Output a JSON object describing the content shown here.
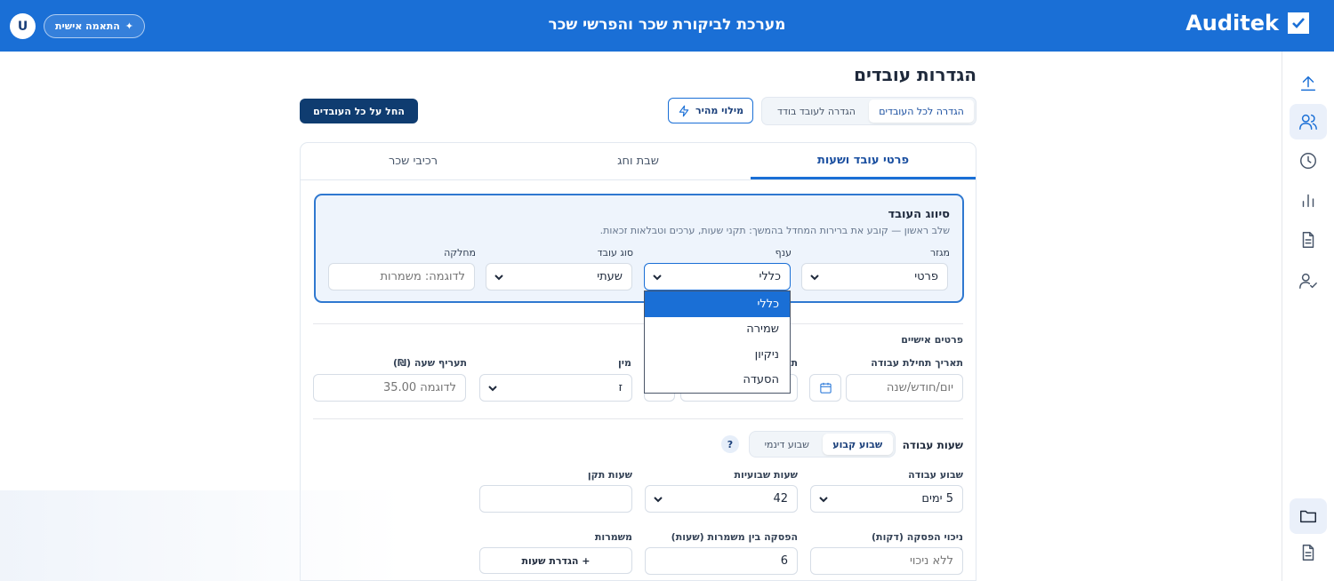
{
  "header": {
    "brand": "Auditek",
    "title": "מערכת לביקורת שכר והפרשי שכר",
    "personal_label": "התאמה אישית",
    "avatar_letter": "U"
  },
  "page": {
    "title": "הגדרות עובדים",
    "mode_options": [
      "הגדרה לכל העובדים",
      "הגדרה לעובד בודד"
    ],
    "quick_fill": "מילוי מהיר",
    "apply_all": "החל על כל העובדים"
  },
  "tabs": [
    "פרטי עובד ושעות",
    "שבת וחג",
    "רכיבי שכר"
  ],
  "classification": {
    "title": "סיווג העובד",
    "subtitle": "שלב ראשון — קובע את ברירות המחדל בהמשך: תקני שעות, ערכים וטבלאות זכאות.",
    "sector_label": "מגזר",
    "sector_value": "פרטי",
    "branch_label": "ענף",
    "branch_value": "כללי",
    "type_label": "סוג עובד",
    "type_value": "שעתי",
    "dept_label": "מחלקה",
    "dept_placeholder": "לדוגמה: משמרות"
  },
  "branch_dropdown": [
    "כללי",
    "שמירה",
    "ניקיון",
    "הסעדה"
  ],
  "personal": {
    "section": "פרטים אישיים",
    "start_label": "תאריך תחילת עבודה",
    "start_placeholder": "יום/חודש/שנה",
    "birth_label_partial": "ת",
    "gender_label": "מין",
    "gender_value": "ז",
    "rate_label": "תעריף שעה (₪)",
    "rate_placeholder": "לדוגמה 35.00"
  },
  "hours": {
    "section": "שעות עבודה",
    "seg_options": [
      "שבוע קבוע",
      "שבוע דינמי"
    ],
    "help": "?",
    "week_label": "שבוע עבודה",
    "week_value": "5 ימים",
    "weekly_label": "שעות שבועיות",
    "weekly_value": "42",
    "std_label": "שעות תקן",
    "break_label": "ניכוי הפסקה (דקות)",
    "break_placeholder": "ללא ניכוי",
    "gap_label": "הפסקה בין משמרות (שעות)",
    "gap_value": "6",
    "shifts_label": "משמרות",
    "shifts_button": "+ הגדרת שעות"
  },
  "sidebar_icons": [
    "upload-icon",
    "users-icon",
    "clock-icon",
    "bar-chart-icon",
    "document-icon",
    "user-check-icon",
    "folder-icon",
    "file-text-icon"
  ]
}
